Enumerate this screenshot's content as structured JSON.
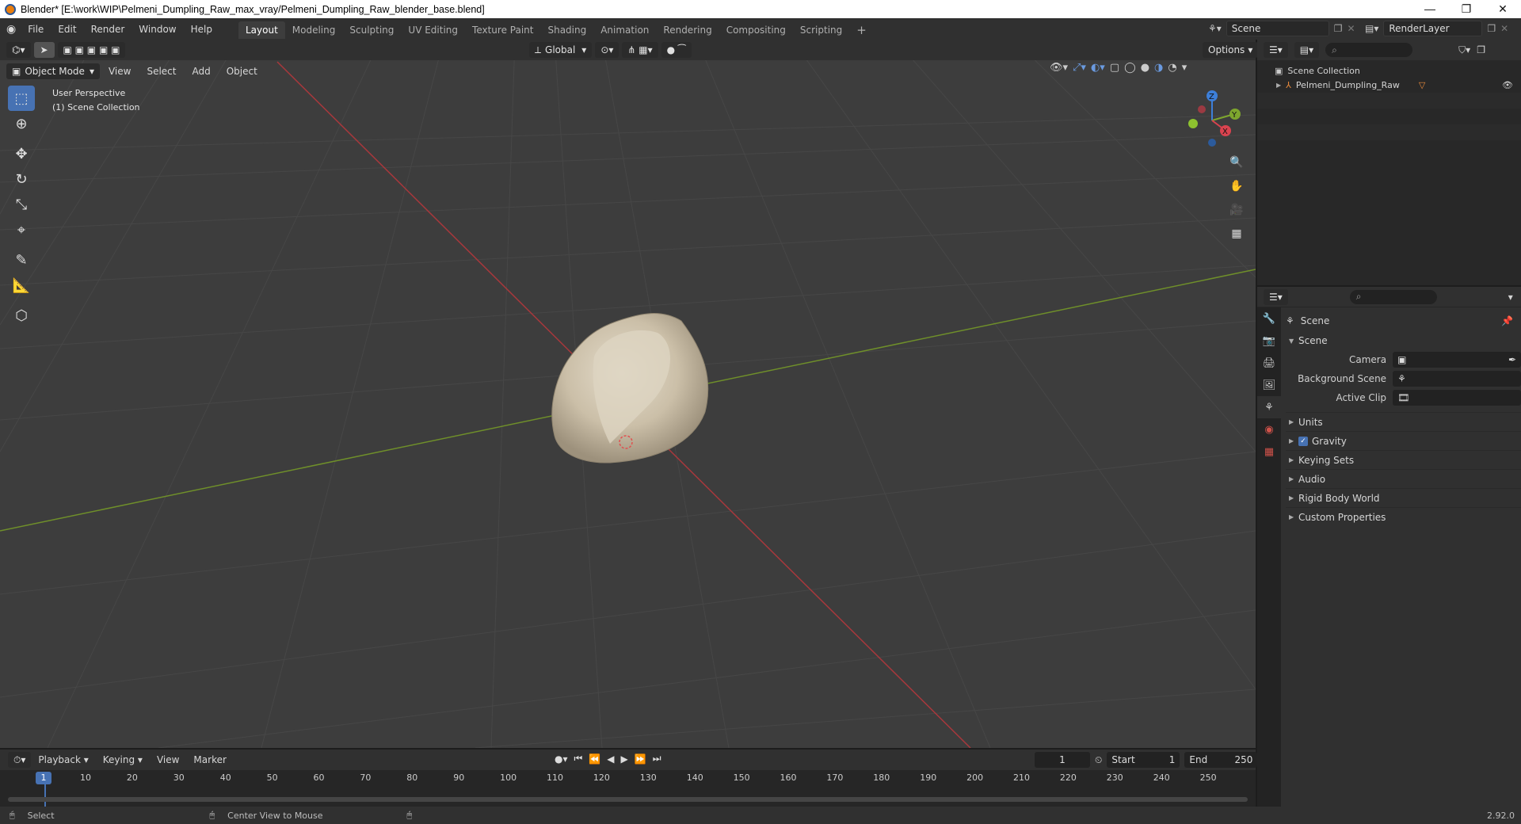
{
  "window": {
    "title": "Blender* [E:\\work\\WIP\\Pelmeni_Dumpling_Raw_max_vray/Pelmeni_Dumpling_Raw_blender_base.blend]"
  },
  "menu": [
    "File",
    "Edit",
    "Render",
    "Window",
    "Help"
  ],
  "workspaces": [
    "Layout",
    "Modeling",
    "Sculpting",
    "UV Editing",
    "Texture Paint",
    "Shading",
    "Animation",
    "Rendering",
    "Compositing",
    "Scripting"
  ],
  "active_workspace": "Layout",
  "top_right": {
    "scene": "Scene",
    "render_layer": "RenderLayer"
  },
  "viewport": {
    "orientation": "Global",
    "options_label": "Options",
    "mode": "Object Mode",
    "menus": [
      "View",
      "Select",
      "Add",
      "Object"
    ],
    "overlay_line1": "User Perspective",
    "overlay_line2": "(1) Scene Collection",
    "gizmo": {
      "x": "X",
      "y": "Y",
      "z": "Z"
    }
  },
  "outliner": {
    "root": "Scene Collection",
    "items": [
      {
        "label": "Pelmeni_Dumpling_Raw"
      }
    ]
  },
  "properties": {
    "context": "Scene",
    "section": "Scene",
    "rows": [
      {
        "label": "Camera",
        "value": ""
      },
      {
        "label": "Background Scene",
        "value": ""
      },
      {
        "label": "Active Clip",
        "value": ""
      }
    ],
    "panels": [
      "Units",
      "Gravity",
      "Keying Sets",
      "Audio",
      "Rigid Body World",
      "Custom Properties"
    ],
    "gravity_checked": true
  },
  "timeline": {
    "menus": [
      "Playback",
      "Keying",
      "View",
      "Marker"
    ],
    "current_frame": "1",
    "start_label": "Start",
    "start": "1",
    "end_label": "End",
    "end": "250",
    "ticks": [
      "1",
      "10",
      "20",
      "30",
      "40",
      "50",
      "60",
      "70",
      "80",
      "90",
      "100",
      "110",
      "120",
      "130",
      "140",
      "150",
      "160",
      "170",
      "180",
      "190",
      "200",
      "210",
      "220",
      "230",
      "240",
      "250"
    ]
  },
  "status": {
    "left": "Select",
    "middle": "Center View to Mouse",
    "version": "2.92.0"
  }
}
